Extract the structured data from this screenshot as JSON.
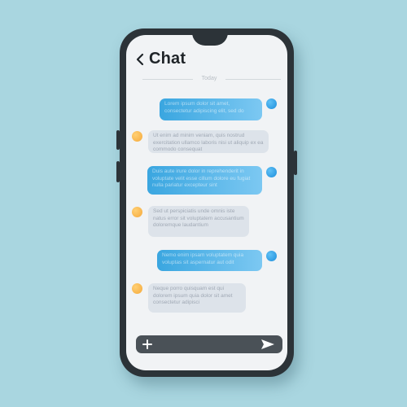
{
  "header": {
    "back_icon": "chevron-left-icon",
    "title": "Chat"
  },
  "date_separator": "Today",
  "messages": [
    {
      "direction": "out",
      "text": "Lorem ipsum dolor sit amet, consectetur adipiscing elit, sed do"
    },
    {
      "direction": "in",
      "text": "Ut enim ad minim veniam, quis nostrud exercitation ullamco laboris nisi ut aliquip ex ea commodo consequat"
    },
    {
      "direction": "out",
      "text": "Duis aute irure dolor in reprehenderit in voluptate velit esse cillum dolore eu fugiat nulla pariatur excepteur sint"
    },
    {
      "direction": "in",
      "text": "Sed ut perspiciatis unde omnis iste natus error sit voluptatem accusantium doloremque laudantium"
    },
    {
      "direction": "out",
      "text": "Nemo enim ipsam voluptatem quia voluptas sit aspernatur aut odit"
    },
    {
      "direction": "in",
      "text": "Neque porro quisquam est qui dolorem ipsum quia dolor sit amet consectetur adipisci"
    }
  ],
  "composer": {
    "placeholder": "",
    "add_icon": "plus-icon",
    "send_icon": "send-icon"
  },
  "colors": {
    "background": "#a9d6e0",
    "phone_frame": "#2c3338",
    "outgoing_bubble": "#3aa6e0",
    "incoming_bubble": "#dde3ea",
    "outgoing_avatar": "#1e8fdc",
    "incoming_avatar": "#f5a93b"
  }
}
